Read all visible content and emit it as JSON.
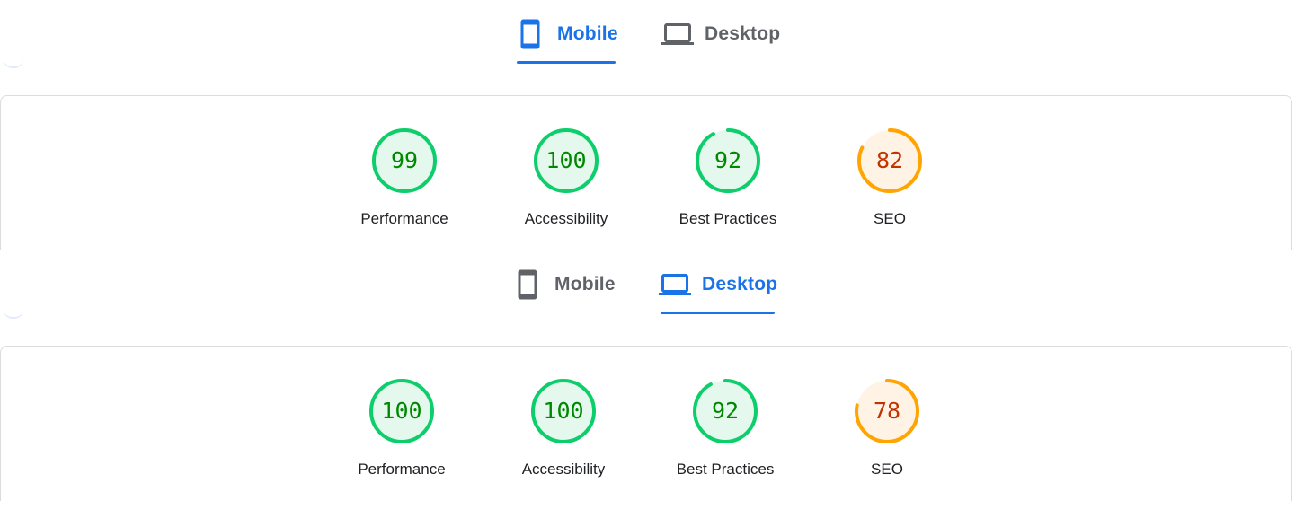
{
  "colors": {
    "accent": "#1a73e8",
    "inactive_tab": "#5f6368",
    "pass_ring": "#0cce6b",
    "pass_fill": "#e5f8ee",
    "pass_text": "#008800",
    "average_ring": "#ffa400",
    "average_fill": "#fff3e5",
    "average_text": "#c33300"
  },
  "panels": [
    {
      "tabs": [
        {
          "label": "Mobile",
          "icon": "smartphone-icon",
          "active": true
        },
        {
          "label": "Desktop",
          "icon": "laptop-icon",
          "active": false
        }
      ],
      "scores": [
        {
          "label": "Performance",
          "value": "99",
          "score": 99,
          "rating": "pass"
        },
        {
          "label": "Accessibility",
          "value": "100",
          "score": 100,
          "rating": "pass"
        },
        {
          "label": "Best Practices",
          "value": "92",
          "score": 92,
          "rating": "pass"
        },
        {
          "label": "SEO",
          "value": "82",
          "score": 82,
          "rating": "average"
        }
      ]
    },
    {
      "tabs": [
        {
          "label": "Mobile",
          "icon": "smartphone-icon",
          "active": false
        },
        {
          "label": "Desktop",
          "icon": "laptop-icon",
          "active": true
        }
      ],
      "scores": [
        {
          "label": "Performance",
          "value": "100",
          "score": 100,
          "rating": "pass"
        },
        {
          "label": "Accessibility",
          "value": "100",
          "score": 100,
          "rating": "pass"
        },
        {
          "label": "Best Practices",
          "value": "92",
          "score": 92,
          "rating": "pass"
        },
        {
          "label": "SEO",
          "value": "78",
          "score": 78,
          "rating": "average"
        }
      ]
    }
  ]
}
